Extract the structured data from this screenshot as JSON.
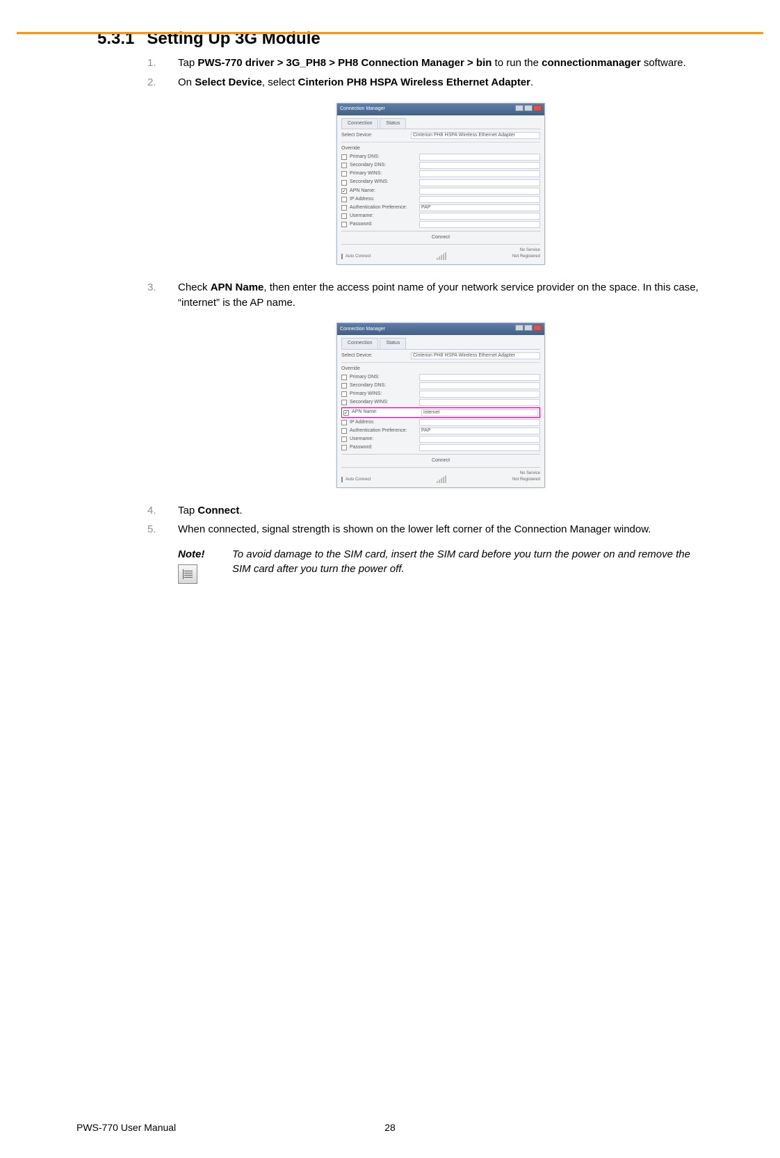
{
  "heading": {
    "number": "5.3.1",
    "title": "Setting Up 3G Module"
  },
  "steps": {
    "s1": {
      "num": "1.",
      "pre": "Tap ",
      "bold1": "PWS-770 driver > 3G_PH8 > PH8 Connection Manager > bin",
      "mid1": " to run the ",
      "bold2": "connectionmanager",
      "post": " software."
    },
    "s2": {
      "num": "2.",
      "pre": "On ",
      "bold1": "Select Device",
      "mid1": ", select ",
      "bold2": "Cinterion PH8 HSPA Wireless Ethernet Adapter",
      "post": "."
    },
    "s3": {
      "num": "3.",
      "pre": "Check ",
      "bold1": "APN Name",
      "post": ", then enter the access point name of your network service provider on the space. In this case, “internet” is the AP name."
    },
    "s4": {
      "num": "4.",
      "pre": "Tap ",
      "bold1": "Connect",
      "post": "."
    },
    "s5": {
      "num": "5.",
      "text": "When connected, signal strength is shown on the lower left corner of the Connection Manager window."
    }
  },
  "note": {
    "label": "Note!",
    "text": "To avoid damage to the SIM card, insert the SIM card before you turn the power on and remove the SIM card after you turn the power off."
  },
  "window": {
    "title": "Connection Manager",
    "tab1": "Connection",
    "tab2": "Status",
    "selectDeviceLabel": "Select Device:",
    "selectDeviceValue": "Cinterion PH8 HSPA Wireless Ethernet Adapter",
    "override": "Override",
    "fields": {
      "primaryDNS": "Primary DNS:",
      "secondaryDNS": "Secondary DNS:",
      "primaryWINS": "Primary WINS:",
      "secondaryWINS": "Secondary WINS:",
      "apnName": "APN Name:",
      "ipAddress": "IP Address:",
      "authPref": "Authentication Preference:",
      "username": "Username:",
      "password": "Password:"
    },
    "apnValue": "internet",
    "authValue": "PAP",
    "connectBtn": "Connect",
    "autoConnect": "Auto Connect",
    "noService": "No Service",
    "notRegistered": "Not Registered"
  },
  "footer": {
    "left": "PWS-770 User Manual",
    "center": "28"
  }
}
